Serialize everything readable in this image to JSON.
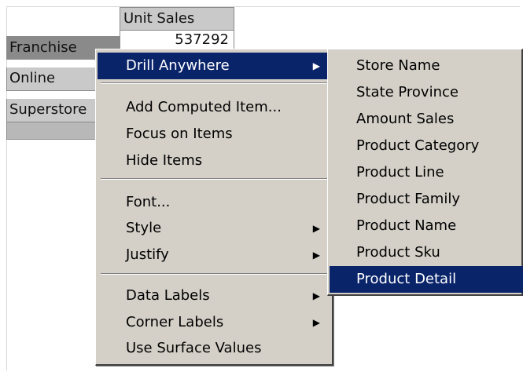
{
  "pivot": {
    "column_header": "Unit Sales",
    "rows": [
      {
        "label": "Franchise",
        "value": "537292"
      },
      {
        "label": "Online",
        "value": ""
      },
      {
        "label": "Superstore",
        "value": ""
      }
    ]
  },
  "context_menu": {
    "items": [
      {
        "label": "Drill Anywhere",
        "submenu": true
      },
      {
        "label": "Add Computed Item...",
        "submenu": false
      },
      {
        "label": "Focus on Items",
        "submenu": false
      },
      {
        "label": "Hide Items",
        "submenu": false
      },
      {
        "label": "Font...",
        "submenu": false
      },
      {
        "label": "Style",
        "submenu": true
      },
      {
        "label": "Justify",
        "submenu": true
      },
      {
        "label": "Data Labels",
        "submenu": true
      },
      {
        "label": "Corner Labels",
        "submenu": true
      },
      {
        "label": "Use Surface Values",
        "submenu": false
      }
    ],
    "arrow_glyph": "▶"
  },
  "drill_submenu": {
    "items": [
      "Store Name",
      "State Province",
      "Amount Sales",
      "Product Category",
      "Product Line",
      "Product Family",
      "Product Name",
      "Product Sku",
      "Product Detail"
    ],
    "selected": "Product Detail"
  },
  "colors": {
    "menu_bg": "#d4d0c8",
    "highlight": "#0a246a",
    "header_bg": "#c9c9c9"
  }
}
